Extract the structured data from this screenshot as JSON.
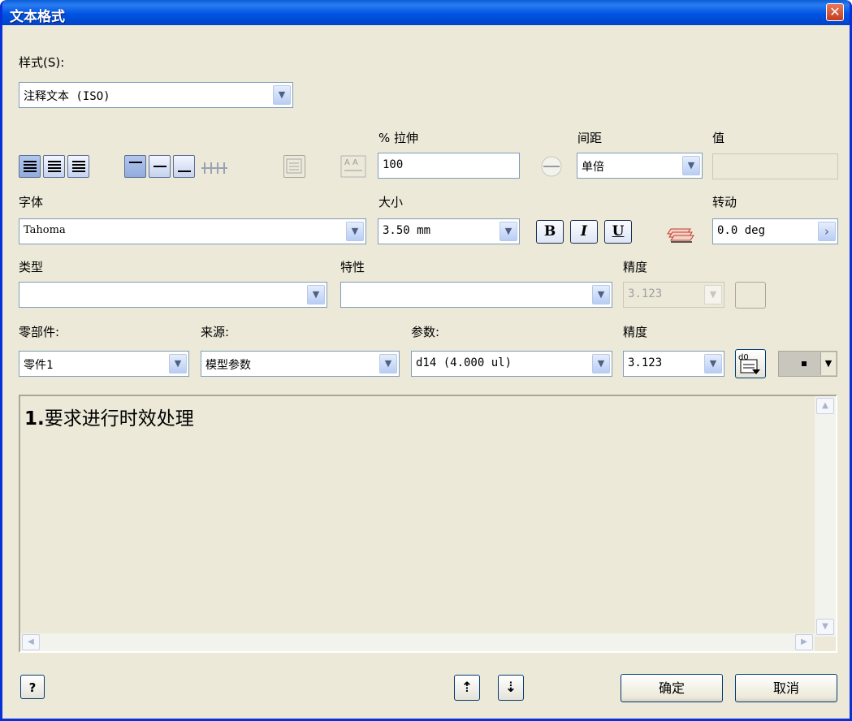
{
  "window": {
    "title": "文本格式",
    "close_label": "✕"
  },
  "style": {
    "label": "样式(S):",
    "value": "注释文本 (ISO)"
  },
  "stretch": {
    "label": "% 拉伸",
    "value": "100"
  },
  "spacing": {
    "label": "间距",
    "value": "单倍"
  },
  "value_field": {
    "label": "值",
    "value": ""
  },
  "font": {
    "label": "字体",
    "value": "Tahoma"
  },
  "size": {
    "label": "大小",
    "value": "3.50 mm"
  },
  "format_buttons": {
    "bold": "B",
    "italic": "I",
    "underline": "U"
  },
  "rotation": {
    "label": "转动",
    "value": "0.0 deg"
  },
  "type": {
    "label": "类型",
    "value": ""
  },
  "property": {
    "label": "特性",
    "value": ""
  },
  "precision1": {
    "label": "精度",
    "value": "3.123"
  },
  "component": {
    "label": "零部件:",
    "value": "零件1"
  },
  "source": {
    "label": "来源:",
    "value": "模型参数"
  },
  "parameter": {
    "label": "参数:",
    "value": "d14 (4.000 ul)"
  },
  "precision2": {
    "label": "精度",
    "value": "3.123"
  },
  "text_body": {
    "prefix": "1.",
    "content": "要求进行时效处理"
  },
  "buttons": {
    "help": "?",
    "ok": "确定",
    "cancel": "取消"
  }
}
